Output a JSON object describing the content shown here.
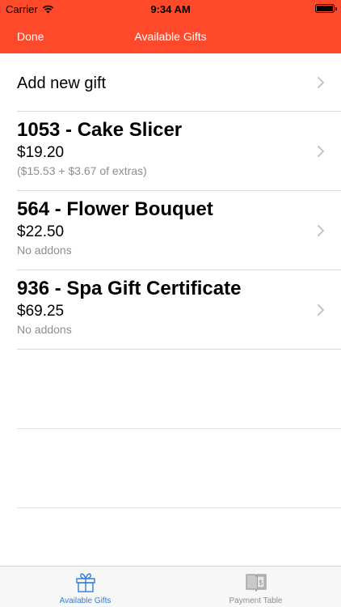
{
  "status_bar": {
    "carrier": "Carrier",
    "time": "9:34 AM"
  },
  "nav": {
    "done_label": "Done",
    "title": "Available Gifts"
  },
  "add_row": {
    "label": "Add new gift"
  },
  "gifts": [
    {
      "name": "1053 - Cake Slicer",
      "price": "$19.20",
      "detail": "($15.53 + $3.67 of extras)"
    },
    {
      "name": "564 - Flower Bouquet",
      "price": "$22.50",
      "detail": "No addons"
    },
    {
      "name": "936 - Spa Gift Certificate",
      "price": "$69.25",
      "detail": "No addons"
    }
  ],
  "tabs": [
    {
      "label": "Available Gifts",
      "icon": "gift-icon",
      "active": true
    },
    {
      "label": "Payment Table",
      "icon": "payment-book-icon",
      "active": false
    }
  ],
  "colors": {
    "accent": "#fe4a2a",
    "tab_active": "#2f7ddb",
    "tab_inactive": "#8e8e8e",
    "secondary_text": "#8e8e8e"
  }
}
